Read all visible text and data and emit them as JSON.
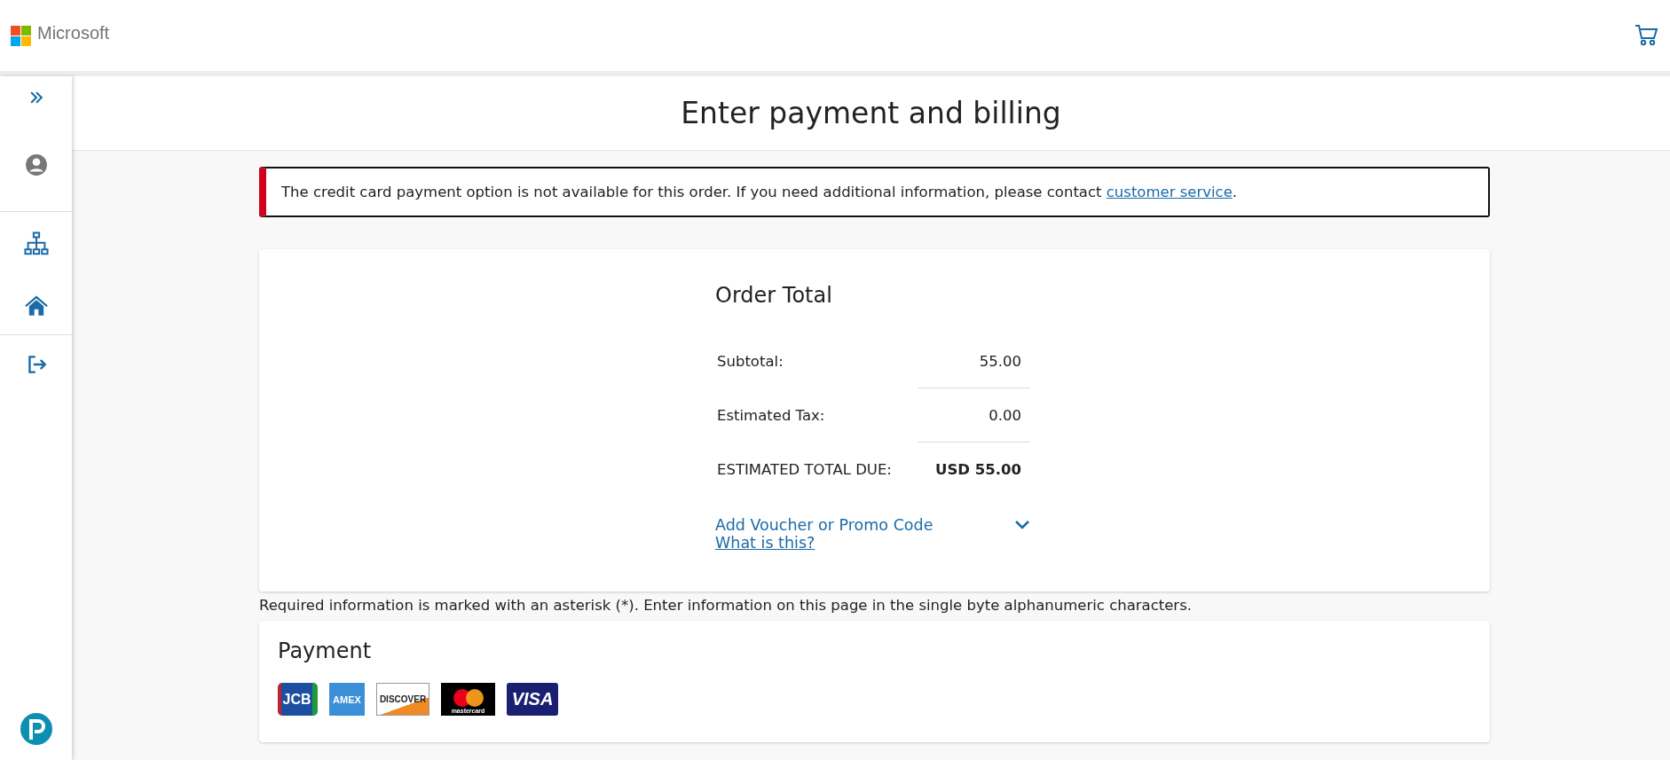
{
  "header": {
    "brand": "Microsoft"
  },
  "sidebar": {
    "items": [
      {
        "kind": "expand"
      },
      {
        "kind": "user"
      },
      {
        "kind": "divider"
      },
      {
        "kind": "sitemap"
      },
      {
        "kind": "home"
      },
      {
        "kind": "divider"
      },
      {
        "kind": "logout"
      }
    ]
  },
  "page_title": "Enter payment and billing",
  "alert": {
    "text": "The credit card payment option is not available for this order. If you need additional information, please contact ",
    "link": "customer service",
    "end": "."
  },
  "order_total": {
    "title": "Order Total",
    "rows": [
      {
        "label": "Subtotal:",
        "value": "55.00",
        "kind": "line"
      },
      {
        "label": "Estimated Tax:",
        "value": "0.00",
        "kind": "line"
      },
      {
        "label": "ESTIMATED TOTAL DUE:",
        "value": "USD 55.00",
        "kind": "total"
      }
    ],
    "voucher": {
      "label": "Add Voucher or Promo Code",
      "expanded": false
    },
    "help_link": "What is this?"
  },
  "note": "Required information is marked with an asterisk (*). Enter information on this page in the single byte alphanumeric characters.",
  "payment": {
    "title": "Payment",
    "card_logos": [
      {
        "kind": "jcb",
        "text": "JCB"
      },
      {
        "kind": "amex",
        "text": "AMEX"
      },
      {
        "kind": "discover",
        "text": "DISCOVER"
      },
      {
        "kind": "mastercard",
        "text": "mastercard"
      },
      {
        "kind": "visa",
        "text": "VISA"
      }
    ]
  }
}
